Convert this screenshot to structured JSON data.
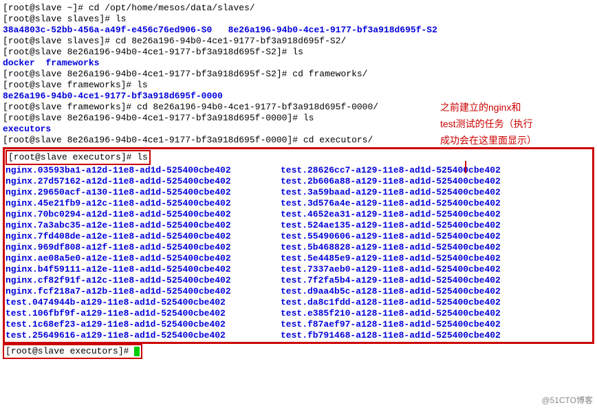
{
  "l1": "[root@slave ~]# cd /opt/home/mesos/data/slaves/",
  "l2": "[root@slave slaves]# ls",
  "l3a": "38a4803c-52bb-456a-a49f-e456c76ed906-S0",
  "l3b": "8e26a196-94b0-4ce1-9177-bf3a918d695f-S2",
  "l4": "[root@slave slaves]# cd 8e26a196-94b0-4ce1-9177-bf3a918d695f-S2/",
  "l5": "[root@slave 8e26a196-94b0-4ce1-9177-bf3a918d695f-S2]# ls",
  "l6a": "docker",
  "l6b": "frameworks",
  "l7": "[root@slave 8e26a196-94b0-4ce1-9177-bf3a918d695f-S2]# cd frameworks/",
  "l8": "[root@slave frameworks]# ls",
  "l9": "8e26a196-94b0-4ce1-9177-bf3a918d695f-0000",
  "l10": "[root@slave frameworks]# cd 8e26a196-94b0-4ce1-9177-bf3a918d695f-0000/",
  "l11": "[root@slave 8e26a196-94b0-4ce1-9177-bf3a918d695f-0000]# ls",
  "l12": "executors",
  "l13": "[root@slave 8e26a196-94b0-4ce1-9177-bf3a918d695f-0000]# cd executors/",
  "bp": "[root@slave executors]# ",
  "bls": "ls",
  "left": [
    "nginx.03593ba1-a12d-11e8-ad1d-525400cbe402",
    "nginx.27d57162-a12d-11e8-ad1d-525400cbe402",
    "nginx.29650acf-a130-11e8-ad1d-525400cbe402",
    "nginx.45e21fb9-a12c-11e8-ad1d-525400cbe402",
    "nginx.70bc0294-a12d-11e8-ad1d-525400cbe402",
    "nginx.7a3abc35-a12e-11e8-ad1d-525400cbe402",
    "nginx.7fd408de-a12e-11e8-ad1d-525400cbe402",
    "nginx.969df808-a12f-11e8-ad1d-525400cbe402",
    "nginx.ae08a5e0-a12e-11e8-ad1d-525400cbe402",
    "nginx.b4f59111-a12e-11e8-ad1d-525400cbe402",
    "nginx.cf82f91f-a12c-11e8-ad1d-525400cbe402",
    "nginx.fcf218a7-a12b-11e8-ad1d-525400cbe402",
    "test.0474944b-a129-11e8-ad1d-525400cbe402",
    "test.106fbf9f-a129-11e8-ad1d-525400cbe402",
    "test.1c68ef23-a129-11e8-ad1d-525400cbe402",
    "test.25649616-a129-11e8-ad1d-525400cbe402"
  ],
  "right": [
    "test.28626cc7-a129-11e8-ad1d-525400cbe402",
    "test.2b606a88-a129-11e8-ad1d-525400cbe402",
    "test.3a59baad-a129-11e8-ad1d-525400cbe402",
    "test.3d576a4e-a129-11e8-ad1d-525400cbe402",
    "test.4652ea31-a129-11e8-ad1d-525400cbe402",
    "test.524ae135-a129-11e8-ad1d-525400cbe402",
    "test.55490606-a129-11e8-ad1d-525400cbe402",
    "test.5b468828-a129-11e8-ad1d-525400cbe402",
    "test.5e4485e9-a129-11e8-ad1d-525400cbe402",
    "test.7337aeb0-a129-11e8-ad1d-525400cbe402",
    "test.7f2fa5b4-a129-11e8-ad1d-525400cbe402",
    "test.d9aa4b5c-a128-11e8-ad1d-525400cbe402",
    "test.da8c1fdd-a128-11e8-ad1d-525400cbe402",
    "test.e385f210-a128-11e8-ad1d-525400cbe402",
    "test.f87aef97-a128-11e8-ad1d-525400cbe402",
    "test.fb791468-a128-11e8-ad1d-525400cbe402"
  ],
  "anno1": "之前建立的nginx和",
  "anno2": "test测试的任务（执行",
  "anno3": "成功会在这里面显示）",
  "wm": "@51CTO博客"
}
